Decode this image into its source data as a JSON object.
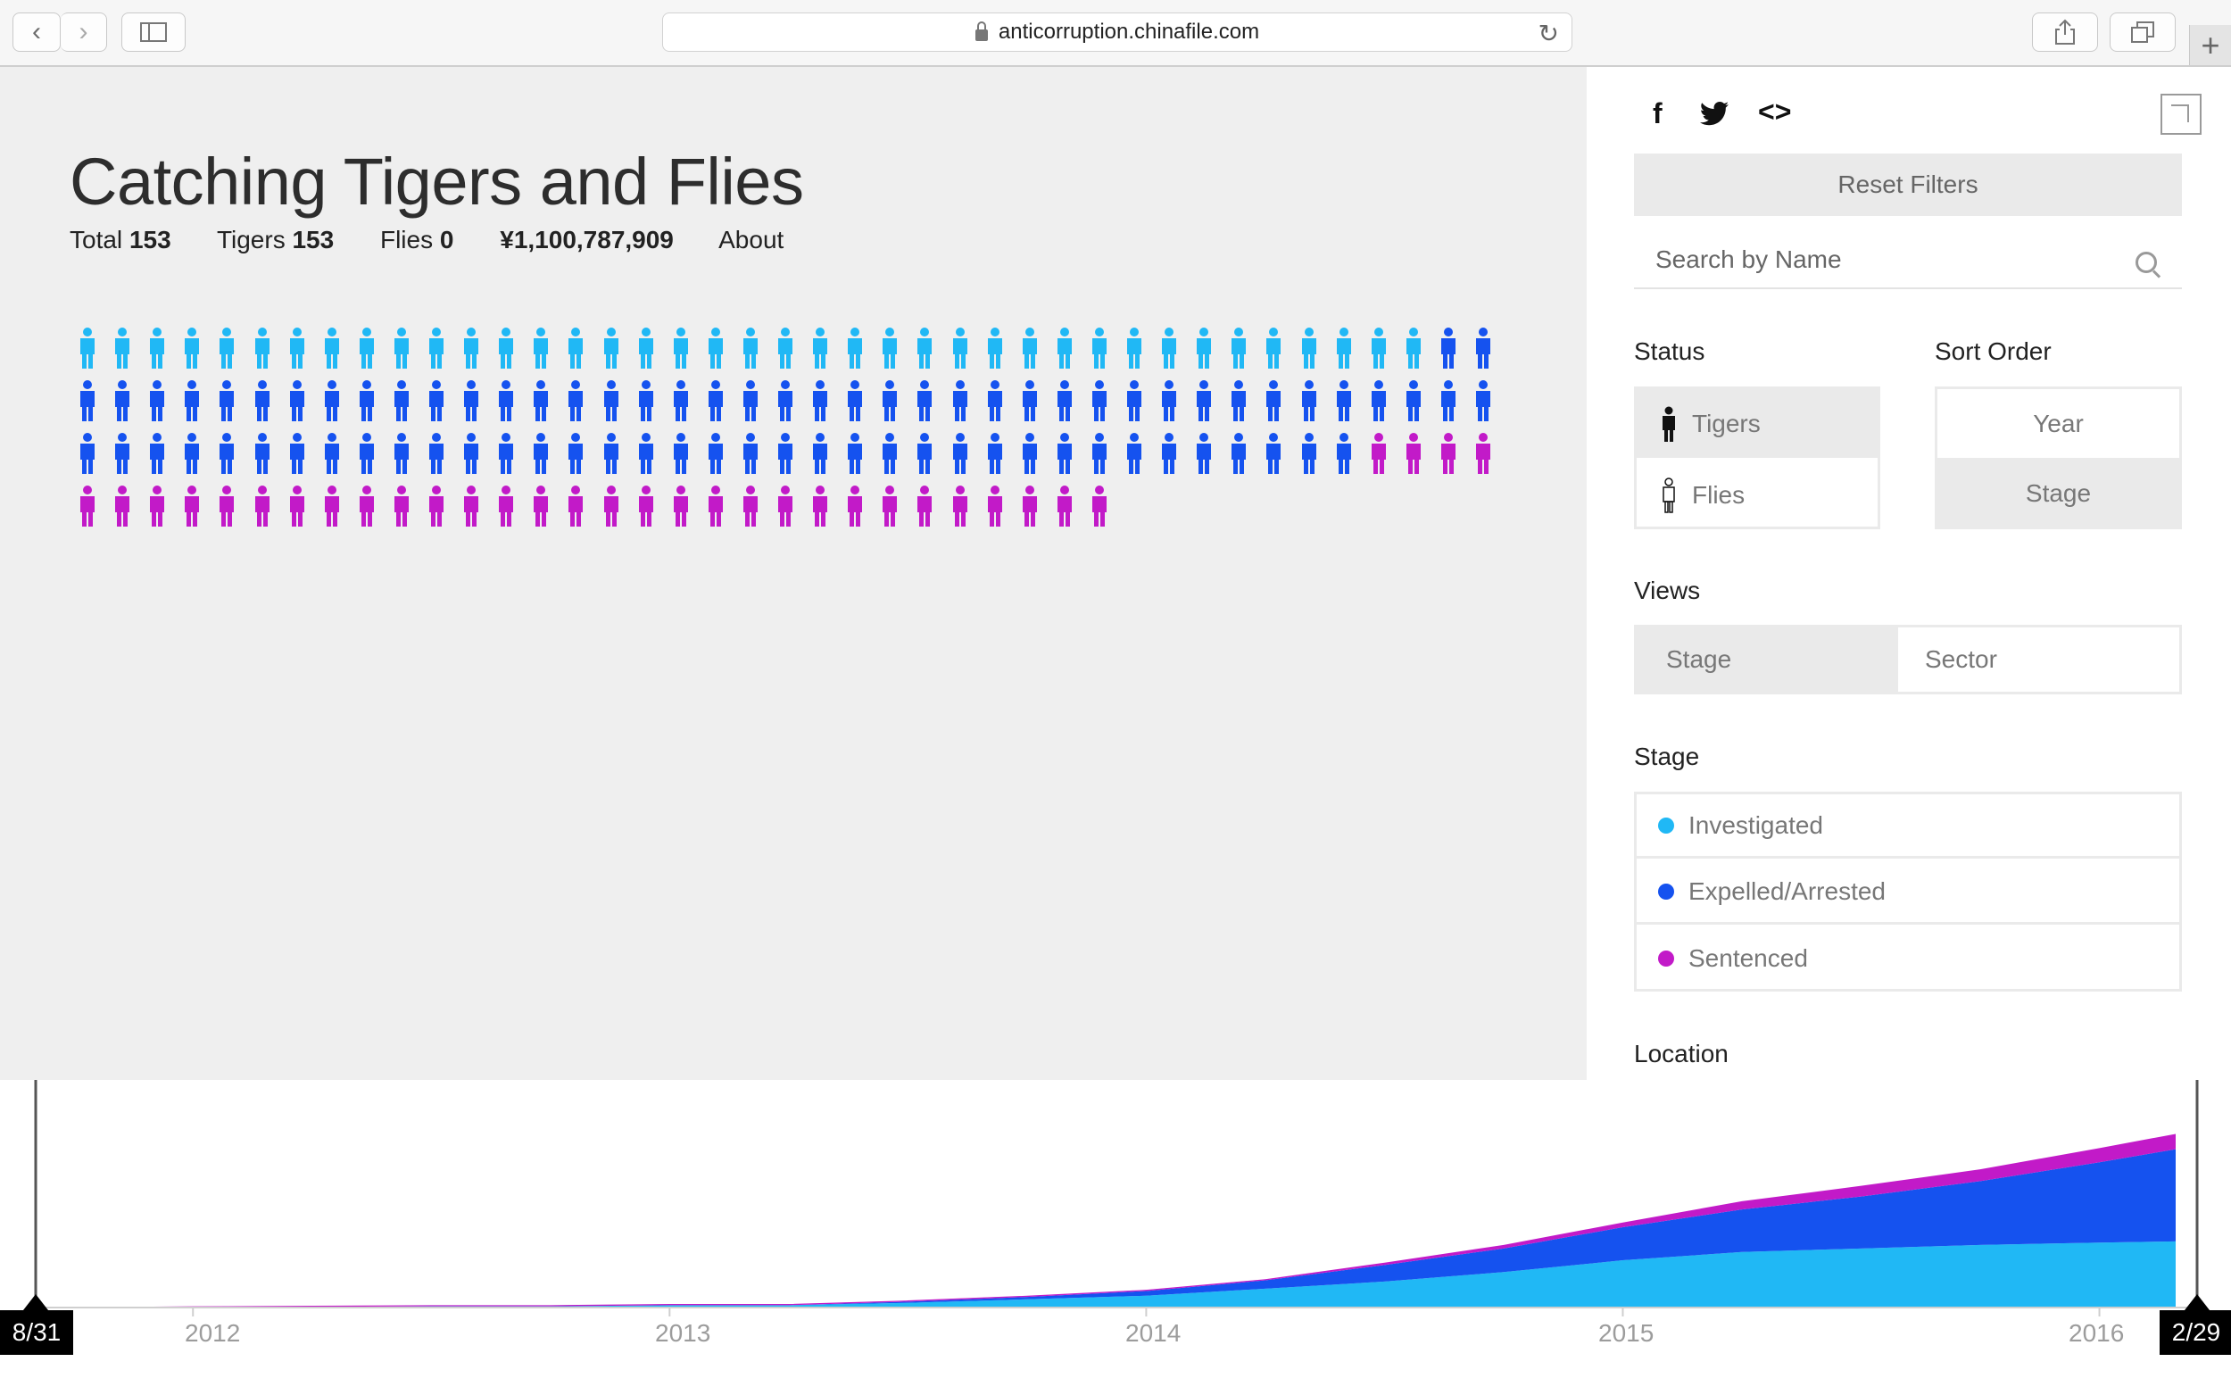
{
  "browser": {
    "url": "anticorruption.chinafile.com",
    "back_icon": "‹",
    "forward_icon": "›",
    "new_tab_icon": "+"
  },
  "viz": {
    "title": "Catching Tigers and Flies",
    "stats": {
      "total_label": "Total",
      "total_value": "153",
      "tigers_label": "Tigers",
      "tigers_value": "153",
      "flies_label": "Flies",
      "flies_value": "0",
      "amount": "¥1,100,787,909",
      "about": "About"
    },
    "people": {
      "columns": 41,
      "groups": [
        {
          "stage": "Investigated",
          "count": 39,
          "color": "#20b8f5"
        },
        {
          "stage": "Expelled/Arrested",
          "count": 80,
          "color": "#1552ef"
        },
        {
          "stage": "Sentenced",
          "count": 34,
          "color": "#c21ac8"
        }
      ]
    }
  },
  "panel": {
    "social": {
      "facebook": "f",
      "embed": "<>"
    },
    "reset_label": "Reset Filters",
    "search_placeholder": "Search by Name",
    "status": {
      "heading": "Status",
      "options": [
        {
          "label": "Tigers",
          "selected": true
        },
        {
          "label": "Flies",
          "selected": false
        }
      ]
    },
    "sort": {
      "heading": "Sort Order",
      "options": [
        {
          "label": "Year",
          "selected": false
        },
        {
          "label": "Stage",
          "selected": true
        }
      ]
    },
    "views": {
      "heading": "Views",
      "options": [
        {
          "label": "Stage",
          "selected": true
        },
        {
          "label": "Sector",
          "selected": false
        }
      ]
    },
    "stage": {
      "heading": "Stage",
      "options": [
        {
          "label": "Investigated",
          "color": "#20b8f5"
        },
        {
          "label": "Expelled/Arrested",
          "color": "#1552ef"
        },
        {
          "label": "Sentenced",
          "color": "#c21ac8"
        }
      ]
    },
    "location_heading": "Location"
  },
  "timeline": {
    "years": [
      "2012",
      "2013",
      "2014",
      "2015",
      "2016"
    ],
    "start_label": "8/31",
    "end_label": "2/29"
  },
  "chart_data": {
    "type": "area",
    "stacked": true,
    "x": [
      2011.67,
      2012.0,
      2012.25,
      2012.5,
      2012.75,
      2013.0,
      2013.25,
      2013.5,
      2013.75,
      2014.0,
      2014.25,
      2014.5,
      2014.75,
      2015.0,
      2015.25,
      2015.5,
      2015.75,
      2016.0,
      2016.16
    ],
    "series": [
      {
        "name": "Investigated",
        "color": "#20b8f5",
        "values": [
          0,
          0,
          0.5,
          1,
          1,
          2,
          2,
          4,
          7,
          10,
          16,
          22,
          30,
          40,
          47,
          50,
          53,
          55,
          56
        ]
      },
      {
        "name": "Expelled/Arrested",
        "color": "#1552ef",
        "values": [
          0,
          0,
          0,
          0,
          0,
          0,
          0,
          1,
          2,
          4,
          7,
          14,
          20,
          28,
          36,
          44,
          54,
          68,
          78
        ]
      },
      {
        "name": "Sentenced",
        "color": "#c21ac8",
        "values": [
          0,
          1,
          1,
          1,
          1,
          1,
          1,
          1,
          1,
          1,
          1,
          2,
          3,
          4,
          7,
          9,
          10,
          12,
          13
        ]
      }
    ],
    "xlim": [
      2011.67,
      2016.16
    ],
    "ylim": [
      0,
      170
    ],
    "xlabel": "",
    "ylabel": ""
  }
}
